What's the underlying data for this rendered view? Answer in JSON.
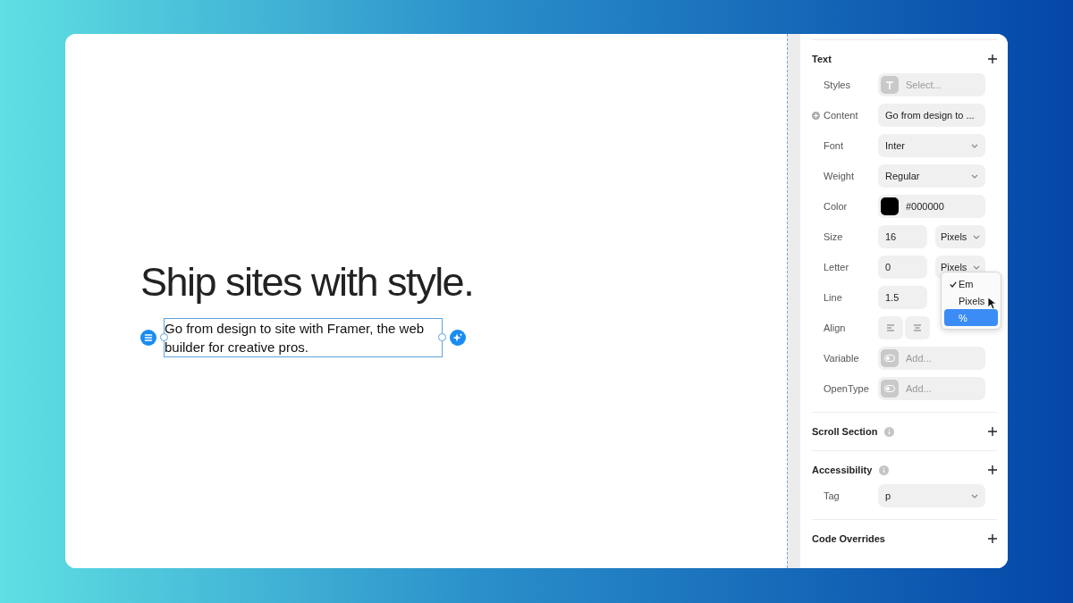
{
  "canvas": {
    "heading": "Ship sites with style.",
    "selected_text": "Go from design to site with Framer, the web builder for creative pros."
  },
  "panel": {
    "sections": [
      {
        "title": "Text",
        "info": false,
        "rows": [
          {
            "kind": "style",
            "label": "Styles",
            "placeholder": "Select...",
            "indicator": false
          },
          {
            "kind": "text",
            "label": "Content",
            "value": "Go from design to ...",
            "indicator": true
          },
          {
            "kind": "select",
            "label": "Font",
            "value": "Inter",
            "indicator": false
          },
          {
            "kind": "select",
            "label": "Weight",
            "value": "Regular",
            "indicator": false
          },
          {
            "kind": "color",
            "label": "Color",
            "value": "#000000",
            "color": "#000000",
            "indicator": false
          },
          {
            "kind": "unit",
            "label": "Size",
            "value": "16",
            "unit": "Pixels",
            "indicator": false
          },
          {
            "kind": "unit",
            "label": "Letter",
            "value": "0",
            "unit": "Pixels",
            "indicator": false
          },
          {
            "kind": "menu",
            "label": "Line",
            "value": "1.5",
            "indicator": false,
            "menu": [
              {
                "label": "Em",
                "checked": true,
                "selected": false
              },
              {
                "label": "Pixels",
                "checked": false,
                "selected": false
              },
              {
                "label": "%",
                "checked": false,
                "selected": true
              }
            ]
          },
          {
            "kind": "align",
            "label": "Align",
            "indicator": false
          },
          {
            "kind": "add",
            "label": "Variable",
            "placeholder": "Add...",
            "indicator": false
          },
          {
            "kind": "add",
            "label": "OpenType",
            "placeholder": "Add...",
            "indicator": false
          }
        ]
      },
      {
        "title": "Scroll Section",
        "info": true
      },
      {
        "title": "Accessibility",
        "info": true,
        "rows": [
          {
            "kind": "select",
            "label": "Tag",
            "value": "p",
            "indicator": false
          }
        ]
      },
      {
        "title": "Code Overrides",
        "info": false
      }
    ]
  }
}
